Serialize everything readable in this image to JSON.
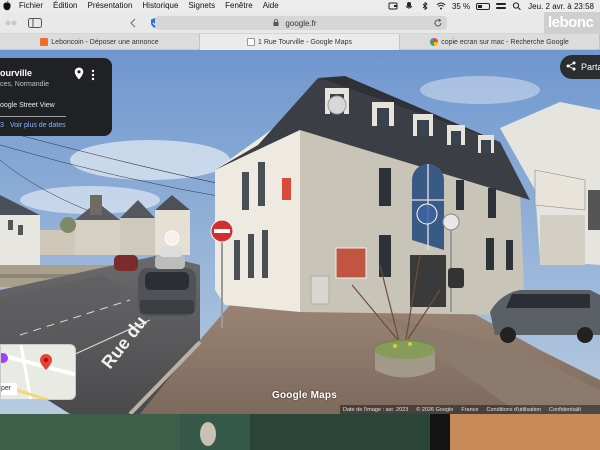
{
  "menubar": {
    "items": [
      "Fichier",
      "Édition",
      "Présentation",
      "Historique",
      "Signets",
      "Fenêtre",
      "Aide"
    ],
    "battery": "35 %",
    "clock": "Jeu. 2 avr. à 23:58"
  },
  "toolbar": {
    "url": "google.fr",
    "brand": "lebonc"
  },
  "tabs": [
    {
      "label": "Leboncoin - Déposer une annonce"
    },
    {
      "label": "1 Rue Tourville - Google Maps"
    },
    {
      "label": "copie ecran sur mac - Recherche Google"
    }
  ],
  "info_card": {
    "title": "ourville",
    "subtitle": "ces, Normandie",
    "street_view_label": "oogle Street View",
    "date_fragment": "3",
    "see_dates": "Voir plus de dates"
  },
  "share_button": {
    "label": "Parta"
  },
  "minimap": {
    "button_label": "per"
  },
  "logo": "Google Maps",
  "street_sign": "Rue du",
  "attribution": [
    "Date de l'image : avr. 2023",
    "© 2026 Google",
    "France",
    "Conditions d'utilisation",
    "Confidentialit"
  ],
  "colors": {
    "menubar_bg": "#ececec",
    "card_bg": "#202124",
    "link_blue": "#8ab4f8",
    "sky": "#7fa6d6",
    "building": "#c9c4b8"
  }
}
